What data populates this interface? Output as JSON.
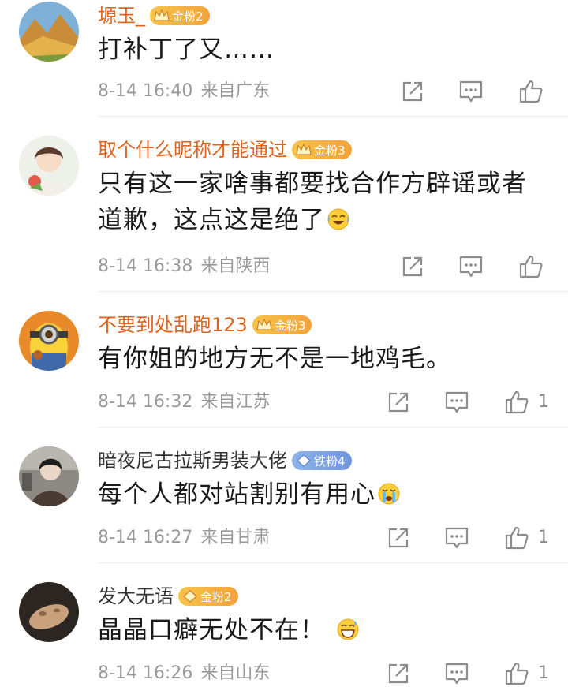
{
  "colors": {
    "gold_name": "#e0641e",
    "plain_name": "#333333",
    "meta": "#9a9a9a",
    "icon": "#8c8c8c"
  },
  "comments": [
    {
      "username": "塬玉_",
      "badge": "金粉2",
      "badge_type": "gold",
      "text": "打补丁了又……",
      "time": "8-14 16:40",
      "location": "来自广东",
      "likes": "",
      "emoji": ""
    },
    {
      "username": "取个什么昵称才能通过",
      "badge": "金粉3",
      "badge_type": "gold",
      "text": "只有这一家啥事都要找合作方辟谣或者道歉，这点这是绝了",
      "time": "8-14 16:38",
      "location": "来自陕西",
      "likes": "",
      "emoji": "laugh-cry-emoji"
    },
    {
      "username": "不要到处乱跑123",
      "badge": "金粉3",
      "badge_type": "gold",
      "text": "有你姐的地方无不是一地鸡毛。",
      "time": "8-14 16:32",
      "location": "来自江苏",
      "likes": "1",
      "emoji": ""
    },
    {
      "username": "暗夜尼古拉斯男装大佬",
      "badge": "铁粉4",
      "badge_type": "iron",
      "text": "每个人都对站割别有用心",
      "time": "8-14 16:27",
      "location": "来自甘肃",
      "likes": "1",
      "emoji": "crying-emoji"
    },
    {
      "username": "发大无语",
      "badge": "金粉2",
      "badge_type": "gold",
      "text": "晶晶口癖无处不在！",
      "time": "8-14 16:26",
      "location": "来自山东",
      "likes": "1",
      "emoji": "grin-sweat-emoji"
    }
  ]
}
